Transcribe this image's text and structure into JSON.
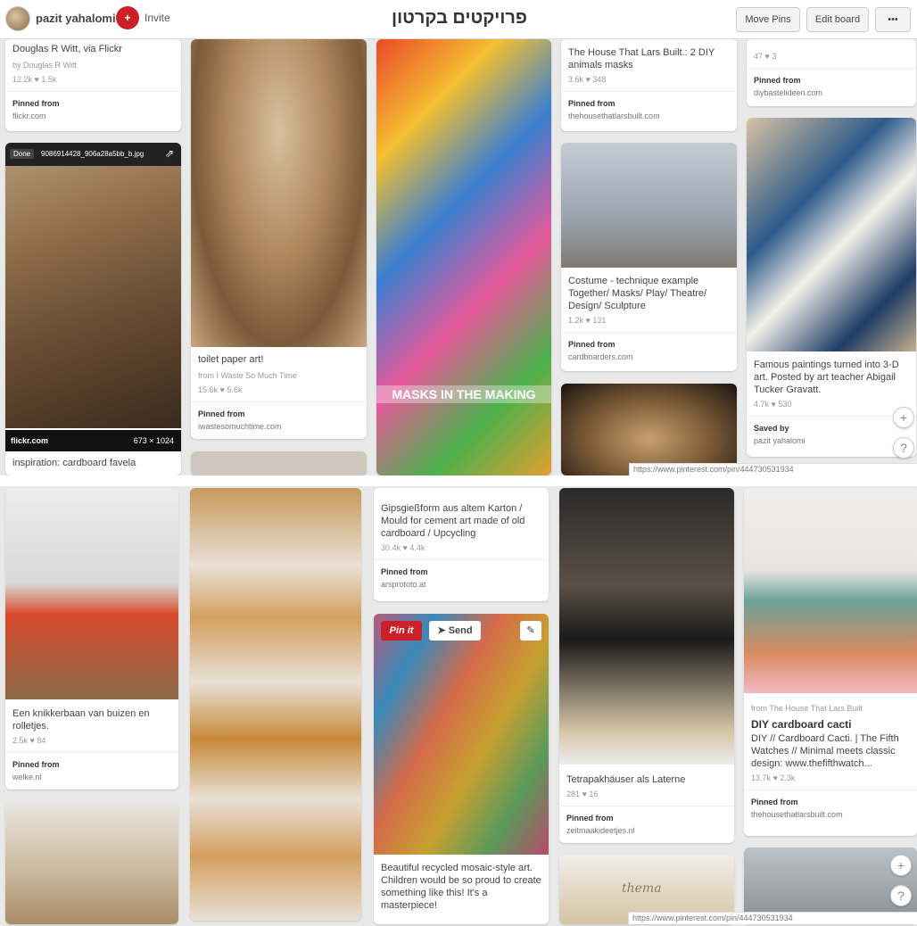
{
  "header": {
    "username": "pazit yahalomi",
    "invite_label": "Invite",
    "board_title": "פרויקטים בקרטון",
    "move_pins": "Move Pins",
    "edit_board": "Edit board",
    "more": "•••"
  },
  "pins": {
    "p1": {
      "title": "Douglas R Witt, via Flickr",
      "via": "by Douglas R Witt",
      "stats": "12.2k ♥ 1.5k",
      "pf": "Pinned from",
      "src": "flickr.com"
    },
    "p2": {
      "done": "Done",
      "filename": "9086914428_906a28a5bb_b.jpg",
      "footer_left": "flickr.com",
      "footer_right": "673 × 1024",
      "title": "inspiration: cardboard favela"
    },
    "p3": {
      "title": "toilet paper art!",
      "via": "from I Waste So Much Time",
      "stats": "15.6k ♥ 5.6k",
      "pf": "Pinned from",
      "src": "iwastesomuchtime.com"
    },
    "p4": {
      "masks_label": "MASKS IN THE MAKING"
    },
    "p5": {
      "title": "The House That Lars Built.: 2 DIY animals masks",
      "stats": "3.6k ♥ 348",
      "pf": "Pinned from",
      "src": "thehousethatlarsbuilt.com"
    },
    "p6": {
      "title": "Costume - technique example Together/ Masks/ Play/ Theatre/ Design/ Sculpture",
      "stats": "1.2k ♥ 131",
      "pf": "Pinned from",
      "src": "cardboarders.com"
    },
    "p7": {
      "stats": "47 ♥ 3",
      "pf": "Pinned from",
      "src": "diybastelideen.com"
    },
    "p8": {
      "title": "Famous paintings turned into 3-D art. Posted by art teacher Abigail Tucker Gravatt.",
      "stats": "4.7k ♥ 530",
      "pf": "Saved by",
      "src": "pazit yahalomi"
    },
    "p9": {
      "title": "Een knikkerbaan van buizen en rolletjes.",
      "stats": "2.5k ♥ 84",
      "pf": "Pinned from",
      "src": "welke.nl"
    },
    "p10": {
      "title": "Gipsgießform aus altem Karton / Mould for cement art made of old cardboard / Upcycling",
      "stats": "30.4k ♥ 4.4k",
      "pf": "Pinned from",
      "src": "arsprototo.at"
    },
    "p11": {
      "pinit": "Pin it",
      "send": "Send",
      "title": "Beautiful recycled mosaic-style art. Children would be so proud to create something like this! It's a masterpiece!"
    },
    "p12": {
      "title": "Tetrapakhäuser als Laterne",
      "stats": "281 ♥ 16",
      "pf": "Pinned from",
      "src": "zeitmaakideetjes.nl"
    },
    "p13": {
      "via": "from The House That Lars Built",
      "heading": "DIY cardboard cacti",
      "title": "DIY // Cardboard Cacti. | The Fifth Watches // Minimal meets classic design: www.thefifthwatch...",
      "stats": "13.7k ♥ 2.3k",
      "pf": "Pinned from",
      "src": "thehousethatlarsbuilt.com"
    },
    "p14": {
      "sign": "thema"
    }
  },
  "overlay": {
    "url_top": "https://www.pinterest.com/pin/444730531934",
    "url_bottom": "https://www.pinterest.com/pin/444730531934",
    "plus": "+",
    "help": "?"
  },
  "colors": {
    "brand_red": "#cb2027",
    "background": "#e9e9e9"
  }
}
